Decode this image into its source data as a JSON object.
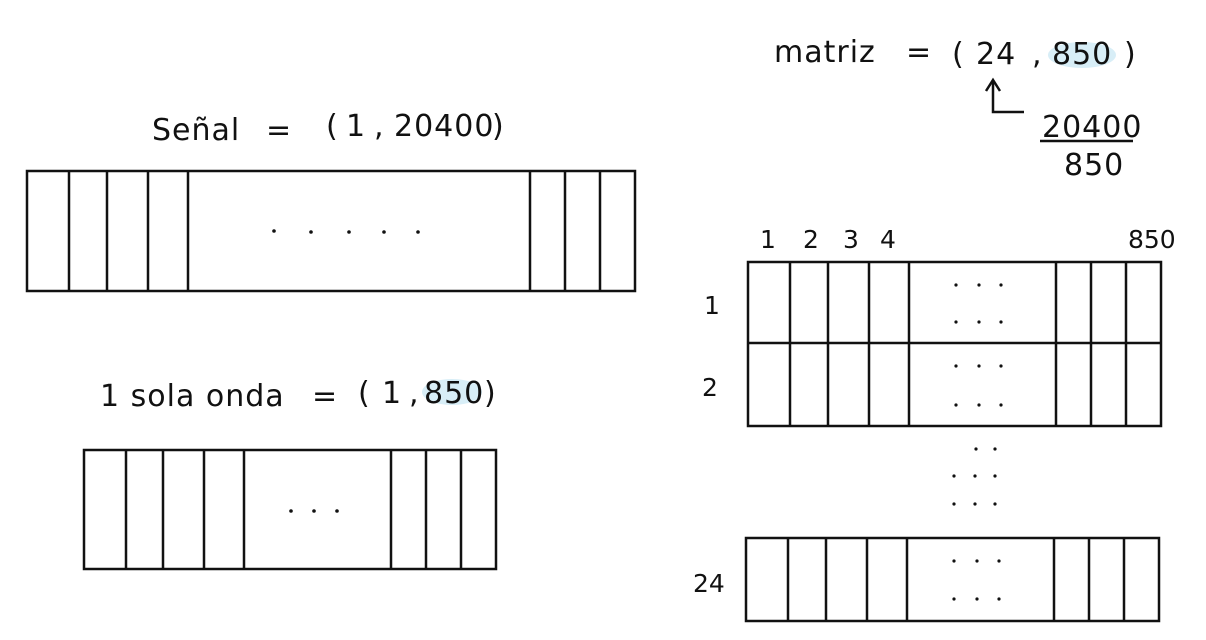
{
  "signal": {
    "name": "Señal",
    "eq": "=",
    "open": "(",
    "one": "1",
    "comma": ",",
    "length": "20400",
    "close": ")"
  },
  "single_wave": {
    "name": "1 sola onda",
    "eq": "=",
    "open": "(",
    "one": "1",
    "comma": ",",
    "length": "850",
    "close": ")"
  },
  "matrix": {
    "name": "matriz",
    "eq": "=",
    "open": "(",
    "rows": "24",
    "comma": ",",
    "cols": "850",
    "close": ")",
    "fraction_numerator": "20400",
    "fraction_denominator": "850",
    "column_labels": [
      "1",
      "2",
      "3",
      "4",
      "850"
    ],
    "row_labels": [
      "1",
      "2",
      "24"
    ]
  },
  "colors": {
    "ink": "#111111",
    "highlight": "#d8eef7"
  }
}
